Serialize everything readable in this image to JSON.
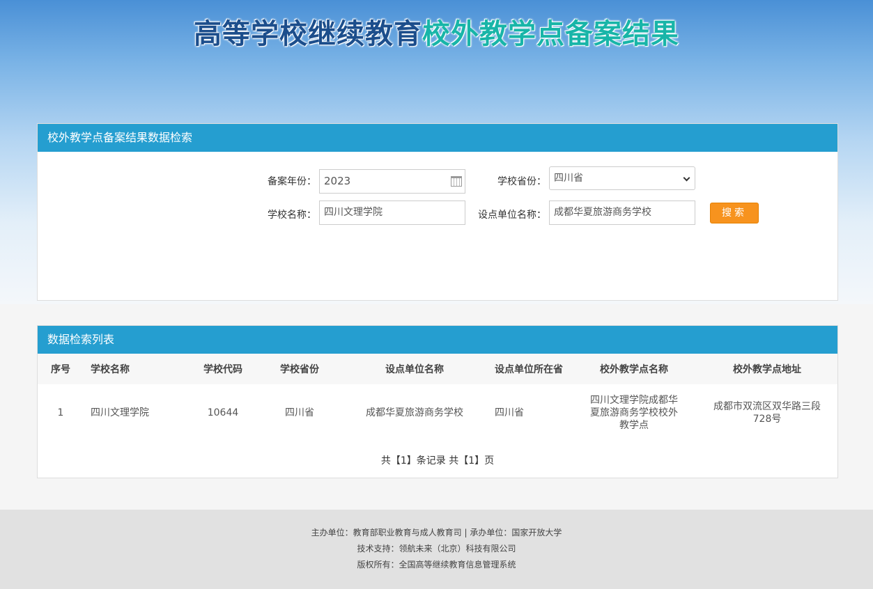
{
  "banner": {
    "title_part1": "高等学校继续教育",
    "title_part2": "校外教学点备案结果"
  },
  "search_panel": {
    "title": "校外教学点备案结果数据检索",
    "year_label": "备案年份：",
    "year_value": "2023",
    "province_label": "学校省份：",
    "province_value": "四川省",
    "school_label": "学校名称：",
    "school_value": "四川文理学院",
    "unit_label": "设点单位名称：",
    "unit_value": "成都华夏旅游商务学校",
    "search_button": "搜索"
  },
  "list_panel": {
    "title": "数据检索列表",
    "columns": [
      "序号",
      "学校名称",
      "学校代码",
      "学校省份",
      "设点单位名称",
      "设点单位所在省",
      "校外教学点名称",
      "校外教学点地址"
    ],
    "rows": [
      {
        "index": "1",
        "school_name": "四川文理学院",
        "school_code": "10644",
        "school_province": "四川省",
        "unit_name": "成都华夏旅游商务学校",
        "unit_province": "四川省",
        "site_name": "四川文理学院成都华夏旅游商务学校校外教学点",
        "site_address": "成都市双流区双华路三段728号"
      }
    ],
    "pagination": "共【1】条记录 共【1】页"
  },
  "footer": {
    "line1": "主办单位：教育部职业教育与成人教育司 | 承办单位：国家开放大学",
    "line2": "技术支持：领航未来（北京）科技有限公司",
    "line3": "版权所有：全国高等继续教育信息管理系统"
  },
  "colors": {
    "header_bar": "#259ed0",
    "search_button": "#f7931e",
    "title_dark": "#1c4e8c",
    "title_teal": "#18b5a8"
  },
  "icons": [
    "calendar-icon",
    "chevron-down-icon"
  ]
}
